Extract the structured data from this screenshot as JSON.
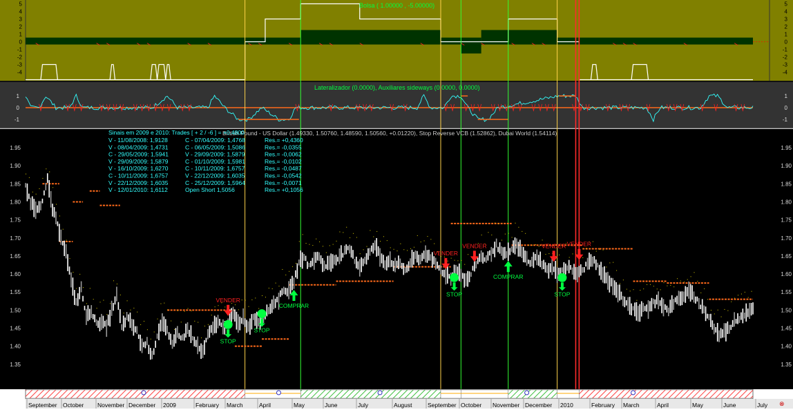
{
  "colors": {
    "top_panel_bg": "#808000",
    "mid_panel_bg": "#333333",
    "main_bg": "#000000",
    "price": "#ffffff",
    "stop_line": "#ff6a1a",
    "sell": "#ff2020",
    "buy": "#00ff40",
    "cyan": "#33ffff",
    "dark_green": "#003300",
    "vline_yellow": "#ffd24a",
    "vline_green": "#33ff33",
    "vline_red": "#ff2a2a"
  },
  "top_panel": {
    "label": "Bolsa ( 1.00000 , -5.00000)",
    "yticks": [
      "5",
      "4",
      "3",
      "2",
      "1",
      "0",
      "-1",
      "-2",
      "-3",
      "-4"
    ]
  },
  "mid_panel": {
    "label": "Lateralizador (0.0000), Auxiliares sideways (0.0000, 0.0000)",
    "yticks": [
      "1",
      "0",
      "-1"
    ]
  },
  "main_panel": {
    "title": "British Pound - US Dollar (1.49330, 1.50760, 1.48590, 1.50560, +0.01220), Stop Reverse VCB (1.52862), Dubai World (1.54114)",
    "yticks": [
      "1.95",
      "1.90",
      "1.85",
      "1.80",
      "1.75",
      "1.70",
      "1.65",
      "1.60",
      "1.55",
      "1.50",
      "1.45",
      "1.40",
      "1.35"
    ],
    "trades_header": "Sinais em 2009 e 2010: Trades [ + 2 / -6 ] = +0.4800",
    "trades": [
      {
        "entry": "V - 11/08/2008: 1,9128",
        "exit": "C - 07/04/2009: 1,4768",
        "result": "Res.= +0,4360"
      },
      {
        "entry": "V - 08/04/2009: 1,4731",
        "exit": "C - 06/05/2009: 1,5086",
        "result": "Res.= -0,0355"
      },
      {
        "entry": "C - 29/05/2009: 1,5941",
        "exit": "V - 29/09/2009: 1,5879",
        "result": "Res.= -0,0062"
      },
      {
        "entry": "V - 29/09/2009: 1,5879",
        "exit": "C - 01/10/2009: 1,5981",
        "result": "Res.= -0,0102"
      },
      {
        "entry": "V - 16/10/2009: 1,6270",
        "exit": "C - 10/11/2009: 1,6757",
        "result": "Res.= -0,0487"
      },
      {
        "entry": "C - 10/11/2009: 1,6757",
        "exit": "V - 22/12/2009: 1,6035",
        "result": "Res.= -0,0542"
      },
      {
        "entry": "V - 22/12/2009: 1,6035",
        "exit": "C - 25/12/2009: 1,5964",
        "result": "Res.= -0,0071"
      },
      {
        "entry": "V - 12/01/2010: 1,6112",
        "exit": "Open Short 1,5056",
        "result": "Res.= +0,1056"
      }
    ],
    "signals": [
      {
        "label": "VENDER",
        "kind": "sell",
        "xi": 120,
        "price": 1.48
      },
      {
        "label": "STOP",
        "kind": "stop",
        "xi": 120,
        "price": 1.46
      },
      {
        "label": "STOP",
        "kind": "stop",
        "xi": 140,
        "price": 1.49
      },
      {
        "label": "COMPRAR",
        "kind": "buy",
        "xi": 159,
        "price": 1.56
      },
      {
        "label": "VENDER",
        "kind": "sell",
        "xi": 249,
        "price": 1.61
      },
      {
        "label": "STOP",
        "kind": "stop",
        "xi": 254,
        "price": 1.59
      },
      {
        "label": "VENDER",
        "kind": "sell",
        "xi": 266,
        "price": 1.63
      },
      {
        "label": "COMPRAR",
        "kind": "buy",
        "xi": 286,
        "price": 1.64
      },
      {
        "label": "VENDER",
        "kind": "sell",
        "xi": 313,
        "price": 1.63
      },
      {
        "label": "STOP",
        "kind": "stop",
        "xi": 318,
        "price": 1.59
      },
      {
        "label": "VENDER",
        "kind": "sell",
        "xi": 328,
        "price": 1.635
      }
    ]
  },
  "time_axis": {
    "labels": [
      "September",
      "October",
      "November",
      "December",
      "2009",
      "February",
      "March",
      "April",
      "May",
      "June",
      "July",
      "August",
      "September",
      "October",
      "November",
      "December",
      "2010",
      "February",
      "March",
      "April",
      "May",
      "June",
      "July"
    ]
  },
  "chart_data": {
    "type": "line",
    "title": "British Pound - US Dollar (1.49330, 1.50760, 1.48590, 1.50560, +0.01220), Stop Reverse VCB (1.52862), Dubai World (1.54114)",
    "xlabel": "",
    "ylabel": "",
    "ylim": [
      1.3,
      1.99
    ],
    "x_range": [
      "September 2008",
      "July 2010"
    ],
    "price_anchors": [
      [
        0,
        1.84
      ],
      [
        3,
        1.8
      ],
      [
        6,
        1.78
      ],
      [
        10,
        1.8
      ],
      [
        13,
        1.86
      ],
      [
        16,
        1.78
      ],
      [
        20,
        1.72
      ],
      [
        24,
        1.66
      ],
      [
        27,
        1.58
      ],
      [
        30,
        1.52
      ],
      [
        33,
        1.56
      ],
      [
        36,
        1.48
      ],
      [
        39,
        1.5
      ],
      [
        42,
        1.46
      ],
      [
        45,
        1.47
      ],
      [
        48,
        1.45
      ],
      [
        51,
        1.5
      ],
      [
        54,
        1.54
      ],
      [
        57,
        1.45
      ],
      [
        60,
        1.48
      ],
      [
        63,
        1.46
      ],
      [
        66,
        1.44
      ],
      [
        69,
        1.4
      ],
      [
        72,
        1.41
      ],
      [
        75,
        1.37
      ],
      [
        78,
        1.43
      ],
      [
        81,
        1.47
      ],
      [
        84,
        1.44
      ],
      [
        87,
        1.4
      ],
      [
        90,
        1.44
      ],
      [
        93,
        1.42
      ],
      [
        96,
        1.45
      ],
      [
        99,
        1.42
      ],
      [
        102,
        1.4
      ],
      [
        105,
        1.38
      ],
      [
        108,
        1.43
      ],
      [
        111,
        1.45
      ],
      [
        114,
        1.47
      ],
      [
        117,
        1.45
      ],
      [
        120,
        1.47
      ],
      [
        123,
        1.49
      ],
      [
        126,
        1.46
      ],
      [
        129,
        1.48
      ],
      [
        132,
        1.45
      ],
      [
        135,
        1.48
      ],
      [
        138,
        1.47
      ],
      [
        141,
        1.48
      ],
      [
        144,
        1.5
      ],
      [
        147,
        1.52
      ],
      [
        150,
        1.53
      ],
      [
        153,
        1.56
      ],
      [
        156,
        1.55
      ],
      [
        159,
        1.58
      ],
      [
        162,
        1.63
      ],
      [
        165,
        1.65
      ],
      [
        168,
        1.62
      ],
      [
        171,
        1.64
      ],
      [
        174,
        1.65
      ],
      [
        177,
        1.62
      ],
      [
        180,
        1.63
      ],
      [
        183,
        1.64
      ],
      [
        186,
        1.65
      ],
      [
        189,
        1.66
      ],
      [
        192,
        1.67
      ],
      [
        195,
        1.64
      ],
      [
        198,
        1.62
      ],
      [
        201,
        1.64
      ],
      [
        204,
        1.66
      ],
      [
        207,
        1.68
      ],
      [
        210,
        1.65
      ],
      [
        213,
        1.63
      ],
      [
        216,
        1.64
      ],
      [
        219,
        1.62
      ],
      [
        222,
        1.63
      ],
      [
        225,
        1.61
      ],
      [
        228,
        1.63
      ],
      [
        231,
        1.65
      ],
      [
        234,
        1.64
      ],
      [
        237,
        1.66
      ],
      [
        240,
        1.64
      ],
      [
        243,
        1.63
      ],
      [
        246,
        1.61
      ],
      [
        249,
        1.6
      ],
      [
        252,
        1.59
      ],
      [
        255,
        1.61
      ],
      [
        258,
        1.6
      ],
      [
        261,
        1.58
      ],
      [
        264,
        1.6
      ],
      [
        267,
        1.63
      ],
      [
        270,
        1.65
      ],
      [
        273,
        1.64
      ],
      [
        276,
        1.66
      ],
      [
        279,
        1.68
      ],
      [
        282,
        1.66
      ],
      [
        285,
        1.65
      ],
      [
        288,
        1.67
      ],
      [
        291,
        1.68
      ],
      [
        294,
        1.66
      ],
      [
        297,
        1.64
      ],
      [
        300,
        1.63
      ],
      [
        303,
        1.65
      ],
      [
        306,
        1.63
      ],
      [
        309,
        1.61
      ],
      [
        312,
        1.62
      ],
      [
        315,
        1.6
      ],
      [
        318,
        1.61
      ],
      [
        321,
        1.62
      ],
      [
        324,
        1.61
      ],
      [
        327,
        1.6
      ],
      [
        330,
        1.61
      ],
      [
        333,
        1.63
      ],
      [
        336,
        1.64
      ],
      [
        339,
        1.62
      ],
      [
        342,
        1.6
      ],
      [
        345,
        1.58
      ],
      [
        348,
        1.57
      ],
      [
        351,
        1.55
      ],
      [
        354,
        1.53
      ],
      [
        357,
        1.52
      ],
      [
        360,
        1.5
      ],
      [
        363,
        1.49
      ],
      [
        366,
        1.51
      ],
      [
        369,
        1.5
      ],
      [
        372,
        1.52
      ],
      [
        375,
        1.53
      ],
      [
        378,
        1.51
      ],
      [
        381,
        1.5
      ],
      [
        384,
        1.52
      ],
      [
        387,
        1.53
      ],
      [
        390,
        1.54
      ],
      [
        393,
        1.55
      ],
      [
        396,
        1.54
      ],
      [
        399,
        1.52
      ],
      [
        402,
        1.5
      ],
      [
        405,
        1.48
      ],
      [
        408,
        1.45
      ],
      [
        411,
        1.43
      ],
      [
        414,
        1.44
      ],
      [
        417,
        1.45
      ],
      [
        420,
        1.47
      ],
      [
        423,
        1.48
      ],
      [
        426,
        1.49
      ],
      [
        429,
        1.5
      ],
      [
        431,
        1.505
      ]
    ],
    "stop_segments": [
      [
        10,
        20,
        1.85
      ],
      [
        20,
        28,
        1.69
      ],
      [
        28,
        34,
        1.8
      ],
      [
        38,
        44,
        1.83
      ],
      [
        44,
        56,
        1.79
      ],
      [
        84,
        124,
        1.5
      ],
      [
        124,
        140,
        1.4
      ],
      [
        140,
        156,
        1.42
      ],
      [
        156,
        184,
        1.57
      ],
      [
        184,
        218,
        1.58
      ],
      [
        218,
        240,
        1.62
      ],
      [
        240,
        252,
        1.62
      ],
      [
        252,
        288,
        1.74
      ],
      [
        288,
        330,
        1.68
      ],
      [
        330,
        340,
        1.67
      ],
      [
        340,
        360,
        1.67
      ],
      [
        360,
        380,
        1.58
      ],
      [
        380,
        405,
        1.575
      ],
      [
        405,
        431,
        1.53
      ]
    ],
    "vlines": [
      {
        "xi": 130,
        "color": "yellow"
      },
      {
        "xi": 163,
        "color": "green"
      },
      {
        "xi": 246,
        "color": "yellow"
      },
      {
        "xi": 258,
        "color": "green"
      },
      {
        "xi": 286,
        "color": "green"
      },
      {
        "xi": 315,
        "color": "yellow"
      },
      {
        "xi": 326,
        "color": "red"
      },
      {
        "xi": 328,
        "color": "red"
      }
    ],
    "oscillator_levels": [
      [
        0,
        130,
        -5
      ],
      [
        130,
        142,
        0
      ],
      [
        142,
        163,
        3
      ],
      [
        163,
        198,
        5
      ],
      [
        198,
        246,
        3
      ],
      [
        246,
        258,
        0
      ],
      [
        258,
        286,
        0
      ],
      [
        286,
        315,
        3
      ],
      [
        315,
        328,
        0
      ],
      [
        328,
        431,
        -5
      ]
    ],
    "oscillator_dark_block": [
      [
        0,
        130,
        0
      ],
      [
        130,
        163,
        0
      ],
      [
        163,
        246,
        1
      ],
      [
        246,
        258,
        0
      ],
      [
        258,
        270,
        -1
      ],
      [
        270,
        286,
        1
      ],
      [
        286,
        315,
        1
      ],
      [
        315,
        431,
        0
      ]
    ],
    "sideways": [
      [
        0,
        1
      ],
      [
        3,
        0
      ],
      [
        8,
        0
      ],
      [
        12,
        1
      ],
      [
        18,
        0
      ],
      [
        26,
        0
      ],
      [
        30,
        1
      ],
      [
        34,
        0
      ],
      [
        60,
        0
      ],
      [
        75,
        0
      ],
      [
        84,
        1
      ],
      [
        90,
        0
      ],
      [
        108,
        0
      ],
      [
        112,
        1
      ],
      [
        118,
        0
      ],
      [
        126,
        -1
      ],
      [
        132,
        -1
      ],
      [
        140,
        0
      ],
      [
        150,
        -1
      ],
      [
        156,
        -1
      ],
      [
        160,
        0
      ],
      [
        200,
        0
      ],
      [
        232,
        0
      ],
      [
        236,
        1
      ],
      [
        240,
        0
      ],
      [
        248,
        0
      ],
      [
        252,
        1
      ],
      [
        258,
        1
      ],
      [
        262,
        0
      ],
      [
        268,
        -1
      ],
      [
        274,
        -1
      ],
      [
        280,
        0
      ],
      [
        316,
        1
      ],
      [
        326,
        1
      ],
      [
        330,
        0
      ],
      [
        364,
        0
      ],
      [
        368,
        0
      ],
      [
        372,
        -1
      ],
      [
        376,
        0
      ],
      [
        400,
        0
      ],
      [
        405,
        1
      ],
      [
        410,
        1
      ],
      [
        416,
        0
      ],
      [
        431,
        0
      ]
    ]
  }
}
